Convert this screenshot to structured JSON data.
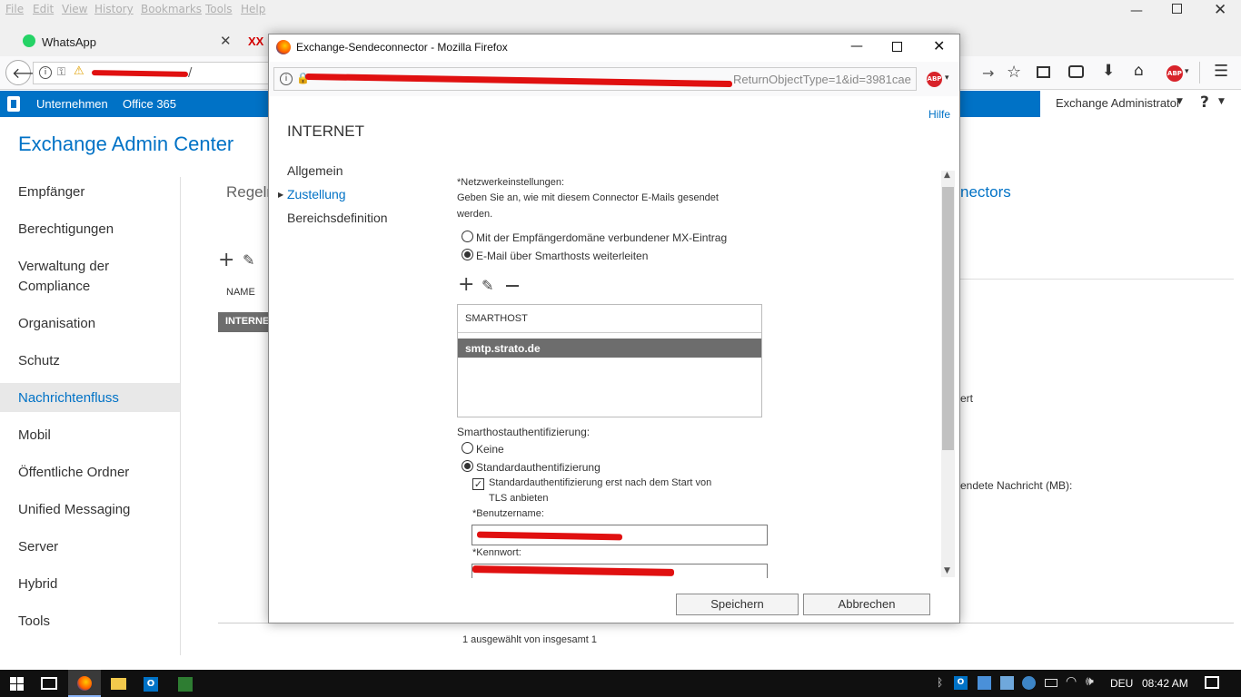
{
  "menubar": {
    "items": [
      "File",
      "Edit",
      "View",
      "History",
      "Bookmarks",
      "Tools",
      "Help"
    ]
  },
  "tabs": [
    {
      "label": "WhatsApp",
      "icon": "whatsapp-icon"
    },
    {
      "label": "XX",
      "icon": "xx-icon"
    }
  ],
  "address": {
    "url_visible": "/"
  },
  "eac": {
    "brand_links": [
      "Unternehmen",
      "Office 365"
    ],
    "admin_label": "Exchange Administrator",
    "help_label": "?",
    "title": "Exchange Admin Center",
    "nav": [
      "Empfänger",
      "Berechtigungen",
      "Verwaltung der",
      "Compliance",
      "Organisation",
      "Schutz",
      "Nachrichtenfluss",
      "Mobil",
      "Öffentliche Ordner",
      "Unified Messaging",
      "Server",
      "Hybrid",
      "Tools"
    ],
    "nav_active": "Nachrichtenfluss",
    "tab_partial": "Regeln",
    "tab_partial_right": "nectors",
    "column_name": "NAME",
    "row_selected": "INTERNET",
    "right_text_1": "ert",
    "right_text_2": "endete Nachricht (MB):",
    "status": "1 ausgewählt von insgesamt 1"
  },
  "dialog": {
    "window_title": "Exchange-Sendeconnector - Mozilla Firefox",
    "url_tail": "ReturnObjectType=1&id=3981cae",
    "help": "Hilfe",
    "heading": "INTERNET",
    "sections": [
      "Allgemein",
      "Zustellung",
      "Bereichsdefinition"
    ],
    "active_section": "Zustellung",
    "network_label": "*Netzwerkeinstellungen:",
    "network_desc_1": "Geben Sie an, wie mit diesem Connector E-Mails gesendet",
    "network_desc_2": "werden.",
    "option_mx": "Mit der Empfängerdomäne verbundener MX-Eintrag",
    "option_smarthost": "E-Mail über Smarthosts weiterleiten",
    "table_header": "SMARTHOST",
    "table_rows": [
      "smtp.strato.de"
    ],
    "auth_label": "Smarthostauthentifizierung:",
    "auth_none": "Keine",
    "auth_basic": "Standardauthentifizierung",
    "tls_line_1": "Standardauthentifizierung erst nach dem Start von",
    "tls_line_2": "TLS anbieten",
    "username_label": "*Benutzername:",
    "password_label": "*Kennwort:",
    "save": "Speichern",
    "cancel": "Abbrechen"
  },
  "taskbar": {
    "lang": "DEU",
    "time": "08:42 AM"
  },
  "colors": {
    "accent": "#0072c6",
    "selected_row": "#6d6d6d",
    "redaction": "#e01010"
  }
}
